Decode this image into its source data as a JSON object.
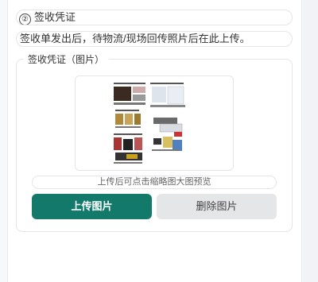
{
  "section": {
    "number": "②",
    "title": "签收凭证"
  },
  "notice": "签收单发出后，待物流/现场回传照片后在此上传。",
  "group": {
    "legend": "签收凭证（图片）",
    "hint": "上传后可点击缩略图大图预览"
  },
  "buttons": {
    "upload": "上传图片",
    "delete": "删除图片"
  },
  "colors": {
    "primary": "#137a6b",
    "secondary": "#e5e6e8"
  }
}
